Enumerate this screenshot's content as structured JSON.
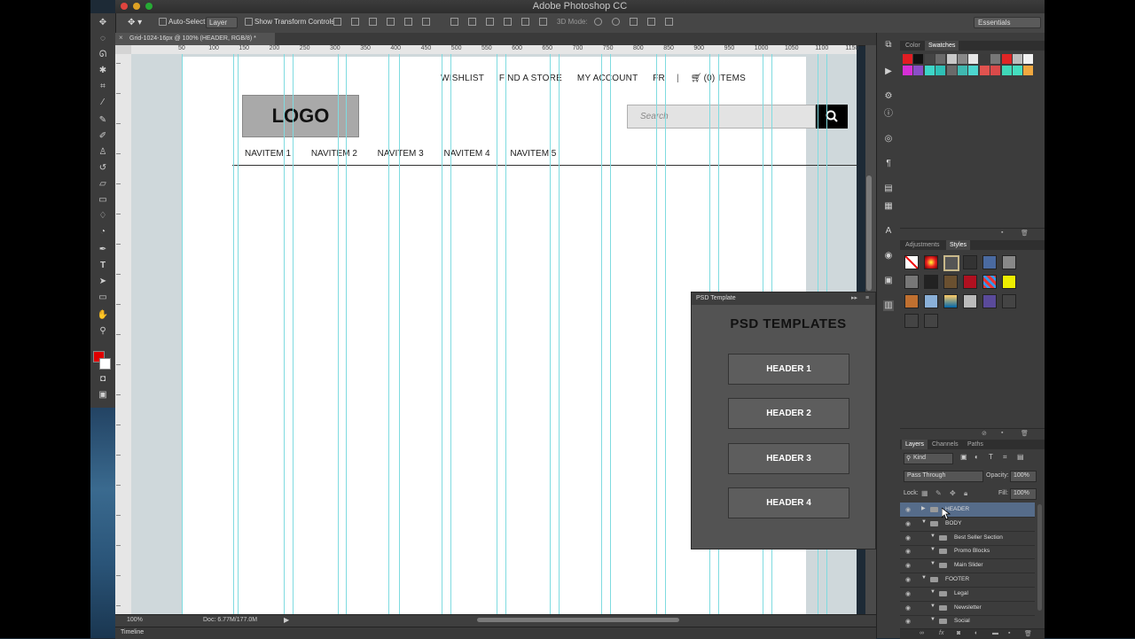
{
  "app": {
    "title": "Adobe Photoshop CC"
  },
  "options_bar": {
    "auto_select_label": "Auto-Select:",
    "auto_select_value": "Layer",
    "transform_label": "Show Transform Controls",
    "mode3d_label": "3D Mode:",
    "workspace": "Essentials"
  },
  "document": {
    "tab_title": "Grid-1024-16px @ 100% (HEADER, RGB/8) *",
    "zoom": "100%",
    "doc_info": "Doc: 6.77M/177.0M"
  },
  "ruler": {
    "labels": [
      "50",
      "100",
      "150",
      "200",
      "250",
      "300",
      "350",
      "400",
      "450",
      "500",
      "550",
      "600",
      "650",
      "700",
      "750",
      "800",
      "850",
      "900",
      "950",
      "1000",
      "1050",
      "1100",
      "1150"
    ]
  },
  "canvas": {
    "top_nav": [
      "WISHLIST",
      "FIND A STORE",
      "MY ACCOUNT",
      "FR"
    ],
    "cart_label": "(0) ITEMS",
    "logo": "LOGO",
    "search_placeholder": "Search",
    "nav_items": [
      "NAVITEM 1",
      "NAVITEM 2",
      "NAVITEM 3",
      "NAVITEM 4",
      "NAVITEM 5"
    ]
  },
  "timeline": {
    "label": "Timeline"
  },
  "panels": {
    "color_tabs": [
      "Color",
      "Swatches"
    ],
    "swatches": [
      "#e21d23",
      "#111111",
      "#444444",
      "#6a6a6a",
      "#c8c8c8",
      "#888888",
      "#e6e6e6",
      "#3b3b3b",
      "#777777",
      "#e02525",
      "#bdbdbd",
      "#f2f2f2",
      "#d62fd6",
      "#8a4fc8",
      "#3dd6c8",
      "#2fc0b6",
      "#6a6a6a",
      "#3fb8b0",
      "#4dd6cf",
      "#e0534f",
      "#d94a4a",
      "#3fd8b8",
      "#45dfc0",
      "#f0a840"
    ],
    "adj_tabs": [
      "Adjustments",
      "Styles"
    ],
    "layer_tabs": [
      "Layers",
      "Channels",
      "Paths"
    ],
    "layer_filter": "Kind",
    "blend_mode": "Pass Through",
    "opacity_label": "Opacity:",
    "opacity": "100%",
    "lock_label": "Lock:",
    "fill_label": "Fill:",
    "fill": "100%",
    "layers": [
      {
        "name": "HEADER",
        "indent": 0,
        "selected": true,
        "expanded": false
      },
      {
        "name": "BODY",
        "indent": 0,
        "selected": false,
        "expanded": true
      },
      {
        "name": "Best Seller Section",
        "indent": 1,
        "selected": false,
        "expanded": true
      },
      {
        "name": "Promo Blocks",
        "indent": 1,
        "selected": false,
        "expanded": true
      },
      {
        "name": "Main Slider",
        "indent": 1,
        "selected": false,
        "expanded": true
      },
      {
        "name": "FOOTER",
        "indent": 0,
        "selected": false,
        "expanded": true
      },
      {
        "name": "Legal",
        "indent": 1,
        "selected": false,
        "expanded": true
      },
      {
        "name": "Newsletter",
        "indent": 1,
        "selected": false,
        "expanded": true
      },
      {
        "name": "Social",
        "indent": 1,
        "selected": false,
        "expanded": true
      }
    ]
  },
  "psd_panel": {
    "tab": "PSD Template",
    "title": "PSD TEMPLATES",
    "buttons": [
      "HEADER 1",
      "HEADER 2",
      "HEADER 3",
      "HEADER 4"
    ]
  }
}
